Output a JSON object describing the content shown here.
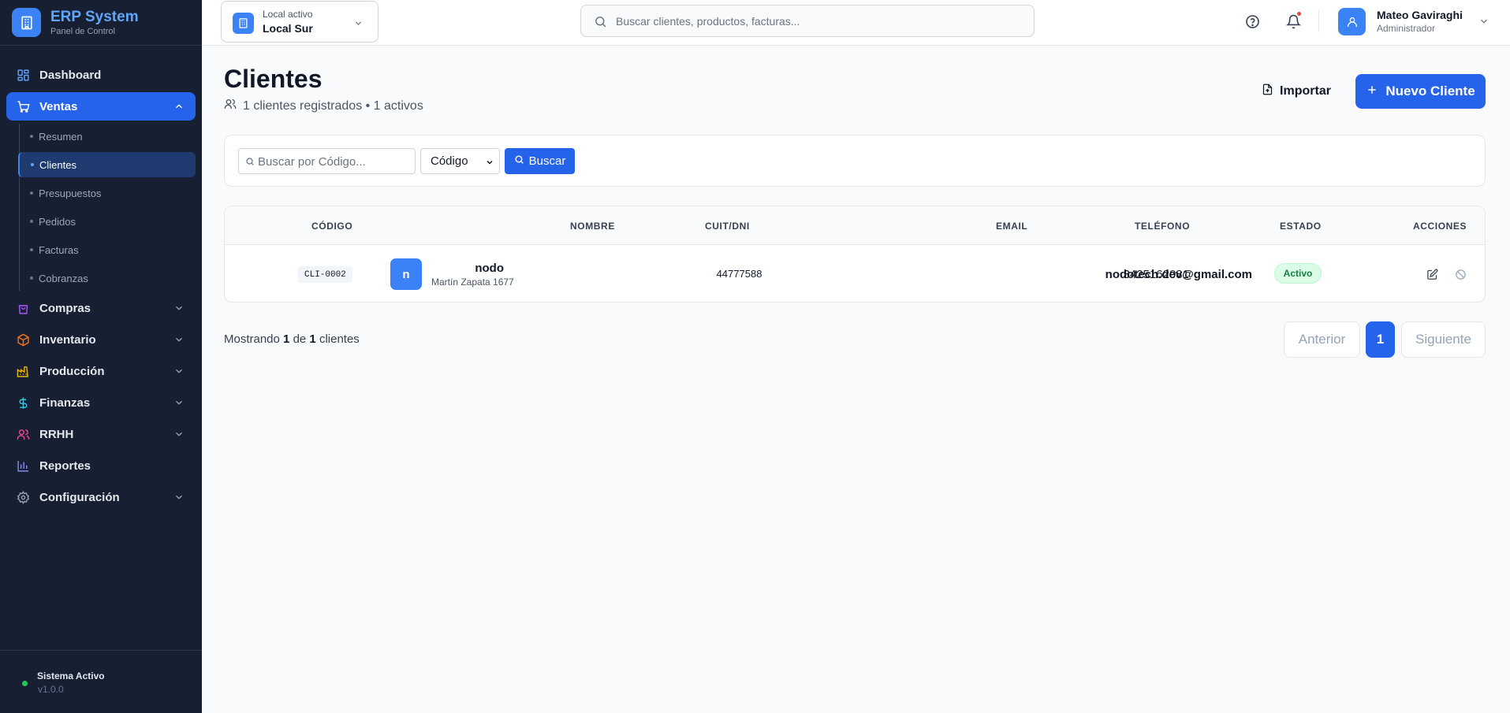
{
  "brand": {
    "title": "ERP System",
    "subtitle": "Panel de Control",
    "icon": "building-icon"
  },
  "sidebar": {
    "items": [
      {
        "label": "Dashboard",
        "icon": "grid-icon",
        "color": "#60a5fa"
      },
      {
        "label": "Ventas",
        "icon": "cart-icon",
        "color": "#ffffff",
        "expanded": true,
        "children": [
          "Resumen",
          "Clientes",
          "Presupuestos",
          "Pedidos",
          "Facturas",
          "Cobranzas"
        ],
        "active_child": "Clientes"
      },
      {
        "label": "Compras",
        "icon": "bag-icon",
        "color": "#a855f7"
      },
      {
        "label": "Inventario",
        "icon": "box-icon",
        "color": "#f97316"
      },
      {
        "label": "Producción",
        "icon": "factory-icon",
        "color": "#eab308"
      },
      {
        "label": "Finanzas",
        "icon": "dollar-icon",
        "color": "#22d3ee"
      },
      {
        "label": "RRHH",
        "icon": "users-icon",
        "color": "#ec4899"
      },
      {
        "label": "Reportes",
        "icon": "bar-chart-icon",
        "color": "#818cf8"
      },
      {
        "label": "Configuración",
        "icon": "gear-icon",
        "color": "#94a3b8"
      }
    ],
    "status": {
      "title": "Sistema Activo",
      "version": "v1.0.0",
      "color": "#22c55e"
    }
  },
  "header": {
    "local_caption": "Local activo",
    "local_name": "Local Sur",
    "search_placeholder": "Buscar clientes, productos, facturas...",
    "user_name": "Mateo Gaviraghi",
    "user_role": "Administrador"
  },
  "page": {
    "title": "Clientes",
    "subtitle": "1 clientes registrados • 1 activos",
    "import_label": "Importar",
    "new_label": "Nuevo Cliente"
  },
  "filter": {
    "search_placeholder": "Buscar por Código...",
    "select_value": "Código",
    "button_label": "Buscar"
  },
  "table": {
    "headers": {
      "codigo": "CÓDIGO",
      "nombre": "NOMBRE",
      "cuit": "CUIT/DNI",
      "email": "EMAIL",
      "telefono": "TELÉFONO",
      "estado": "ESTADO",
      "acciones": "ACCIONES"
    },
    "rows": [
      {
        "codigo": "CLI-0002",
        "initial": "n",
        "nombre": "nodo",
        "direccion": "Martín Zapata 1677",
        "cuit": "44777588",
        "email": "nodotech.dev@gmail.com",
        "telefono": "3425162081",
        "estado": "Activo"
      }
    ]
  },
  "footer": {
    "showing_prefix": "Mostrando",
    "showing_from": "1",
    "showing_mid": "de",
    "showing_total": "1",
    "showing_suffix": "clientes",
    "prev_label": "Anterior",
    "current_page": "1",
    "next_label": "Siguiente"
  },
  "colors": {
    "accent": "#2563eb",
    "sidebar_bg": "#172033",
    "success": "#15803d"
  }
}
